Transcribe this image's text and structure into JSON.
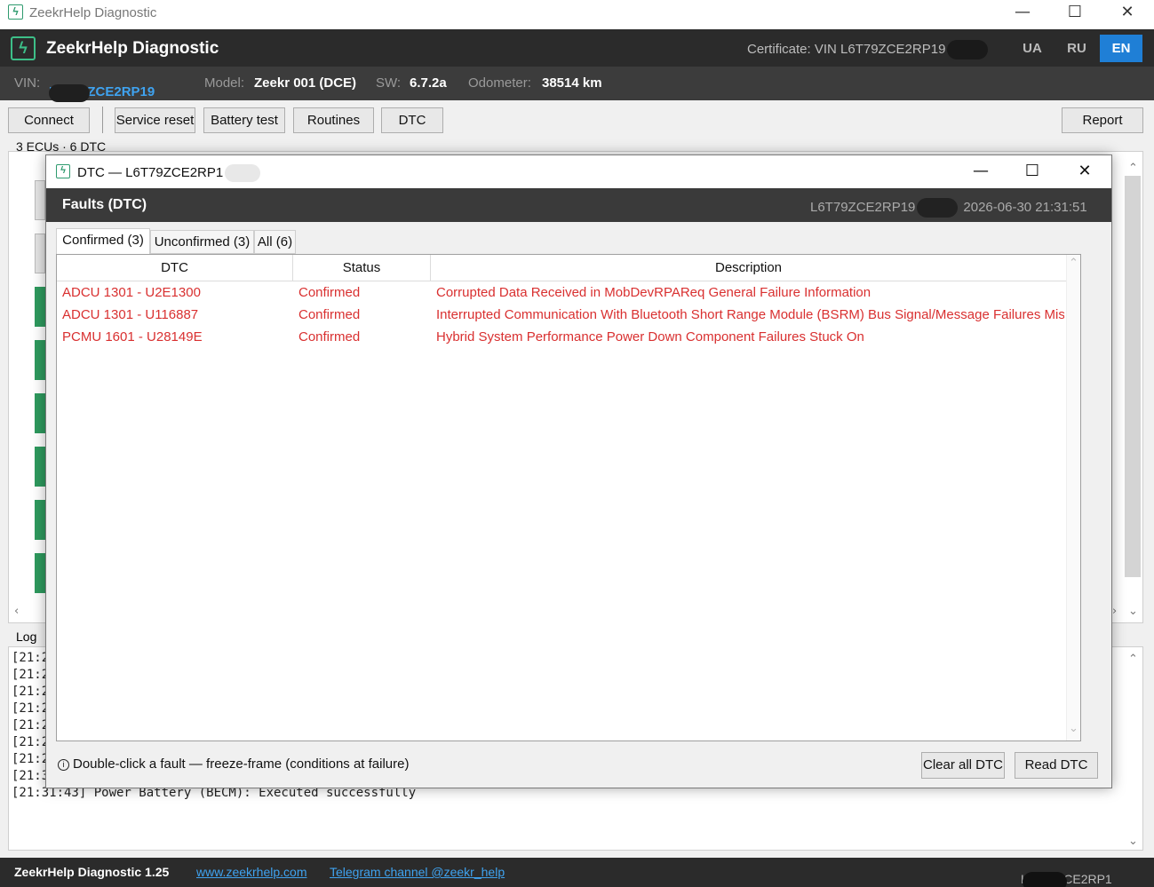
{
  "window": {
    "title": "ZeekrHelp Diagnostic",
    "controls": {
      "minimize": "—",
      "maximize": "☐",
      "close": "✕"
    }
  },
  "header": {
    "logo_glyph": "ϟ",
    "brand": "ZeekrHelp Diagnostic",
    "certificate": "Certificate: VIN L6T79ZCE2RP19",
    "languages": [
      {
        "code": "UA",
        "active": false
      },
      {
        "code": "RU",
        "active": false
      },
      {
        "code": "EN",
        "active": true
      }
    ]
  },
  "vehicle": {
    "vin_label": "VIN:",
    "vin": "L6T79ZCE2RP19",
    "model_label": "Model:",
    "model": "Zeekr 001 (DCE)",
    "sw_label": "SW:",
    "sw": "6.7.2a",
    "odometer_label": "Odometer:",
    "odometer": "38514 km"
  },
  "toolbar": {
    "connect": "Connect",
    "service_reset": "Service reset",
    "battery_test": "Battery test",
    "routines": "Routines",
    "dtc": "DTC",
    "report": "Report"
  },
  "summary": "3 ECUs · 6 DTC",
  "log": {
    "label": "Log",
    "lines": [
      "[21:2",
      "[21:2",
      "[21:2",
      "[21:2",
      "[21:2",
      "[21:2",
      "[21:2",
      "[21:3",
      "[21:31:43] Power Battery (BECM): Executed successfully"
    ]
  },
  "statusbar": {
    "version": "ZeekrHelp Diagnostic 1.25",
    "website": "www.zeekrhelp.com",
    "telegram": "Telegram channel @zeekr_help",
    "vin": "L6T79ZCE2RP1"
  },
  "dialog": {
    "title": "DTC — L6T79ZCE2RP1",
    "header_title": "Faults (DTC)",
    "header_vin": "L6T79ZCE2RP19",
    "header_datetime": "2026-06-30 21:31:51",
    "tabs": [
      {
        "label": "Confirmed (3)",
        "active": true
      },
      {
        "label": "Unconfirmed (3)",
        "active": false
      },
      {
        "label": "All (6)",
        "active": false
      }
    ],
    "columns": {
      "dtc": "DTC",
      "status": "Status",
      "description": "Description"
    },
    "rows": [
      {
        "dtc": "ADCU 1301 - U2E1300",
        "status": "Confirmed",
        "description": "Corrupted Data Received in MobDevRPAReq General Failure Information"
      },
      {
        "dtc": "ADCU 1301 - U116887",
        "status": "Confirmed",
        "description": "Interrupted Communication With Bluetooth Short Range Module (BSRM) Bus Signal/Message Failures Missing"
      },
      {
        "dtc": "PCMU 1601 - U28149E",
        "status": "Confirmed",
        "description": "Hybrid System Performance Power Down Component Failures Stuck On"
      }
    ],
    "hint": "Double-click a fault — freeze-frame (conditions at failure)",
    "clear_all": "Clear all DTC",
    "read_dtc": "Read DTC",
    "fault_color": "#d93030"
  },
  "colors": {
    "accent": "#1f7fd6",
    "link": "#3fa3f0",
    "brand_green": "#3dbf88",
    "dark_bar": "#2b2b2b"
  }
}
